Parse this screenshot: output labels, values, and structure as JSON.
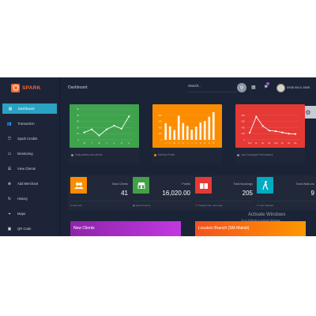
{
  "brand": {
    "name": "SPARK"
  },
  "sidebar": {
    "items": [
      {
        "label": "Dashboard",
        "icon": "grid-icon",
        "active": true
      },
      {
        "label": "Transaction",
        "icon": "users-icon"
      },
      {
        "label": "Spark Credits",
        "icon": "shield-icon"
      },
      {
        "label": "Monitoring",
        "icon": "monitor-icon"
      },
      {
        "label": "View Clients",
        "icon": "list-icon"
      },
      {
        "label": "Add Merchant",
        "icon": "add-user-icon"
      },
      {
        "label": "History",
        "icon": "refresh-icon"
      },
      {
        "label": "Maps",
        "icon": "map-pin-icon"
      },
      {
        "label": "QR Code",
        "icon": "qr-icon"
      }
    ]
  },
  "header": {
    "title": "Dashboard",
    "search_placeholder": "Search...",
    "user_name": "0938 0614 1585"
  },
  "charts": {
    "green": {
      "footer": "Daily activity new clients",
      "color": "#3fa34d",
      "chart_data": {
        "type": "line",
        "categories": [
          "M",
          "T",
          "W",
          "T",
          "F",
          "S",
          "S"
        ],
        "values": [
          12,
          17,
          7,
          17,
          23,
          18,
          38
        ],
        "ylim": [
          0,
          50
        ],
        "yticks": [
          0,
          10,
          20,
          30,
          40,
          50
        ]
      }
    },
    "orange": {
      "footer": "Monthly Profits",
      "color": "#fb8c00",
      "chart_data": {
        "type": "bar",
        "categories": [
          "J",
          "F",
          "M",
          "A",
          "M",
          "J",
          "J",
          "A",
          "S",
          "O",
          "N",
          "D"
        ],
        "values": [
          540,
          440,
          320,
          780,
          550,
          450,
          330,
          430,
          560,
          610,
          750,
          900
        ],
        "ylim": [
          0,
          1000
        ],
        "yticks": [
          0,
          200,
          400,
          600,
          800
        ]
      }
    },
    "red": {
      "footer": "Last Campaign Performance",
      "color": "#e53935",
      "chart_data": {
        "type": "line",
        "categories": [
          "12p",
          "3p",
          "6p",
          "9p",
          "12p",
          "3a",
          "6a",
          "9a"
        ],
        "values": [
          230,
          750,
          450,
          300,
          280,
          240,
          200,
          190
        ],
        "ylim": [
          0,
          1000
        ],
        "yticks": [
          0,
          200,
          400,
          600,
          800
        ]
      }
    }
  },
  "stats": [
    {
      "label": "Total Clients",
      "value": "41",
      "footer": "View info",
      "icon": "users-icon",
      "color": "#fb8c00"
    },
    {
      "label": "Profits",
      "value": "16,020.00",
      "footer": "Last 24 Hours",
      "icon": "store-icon",
      "color": "#43a047"
    },
    {
      "label": "Total Bookings",
      "value": "205",
      "footer": "Tracked from other app",
      "icon": "book-icon",
      "color": "#e53935"
    },
    {
      "label": "Total Walk-ins",
      "value": "9",
      "footer": "Just Updated",
      "icon": "walking-icon",
      "color": "#00acc1"
    }
  ],
  "panels": {
    "new_clients": {
      "title": "New Clients"
    },
    "location": {
      "title": "Location Branch (SM Makati)"
    }
  },
  "watermark": {
    "title": "Activate Windows",
    "subtitle": "Go to Settings to activate Windows."
  }
}
